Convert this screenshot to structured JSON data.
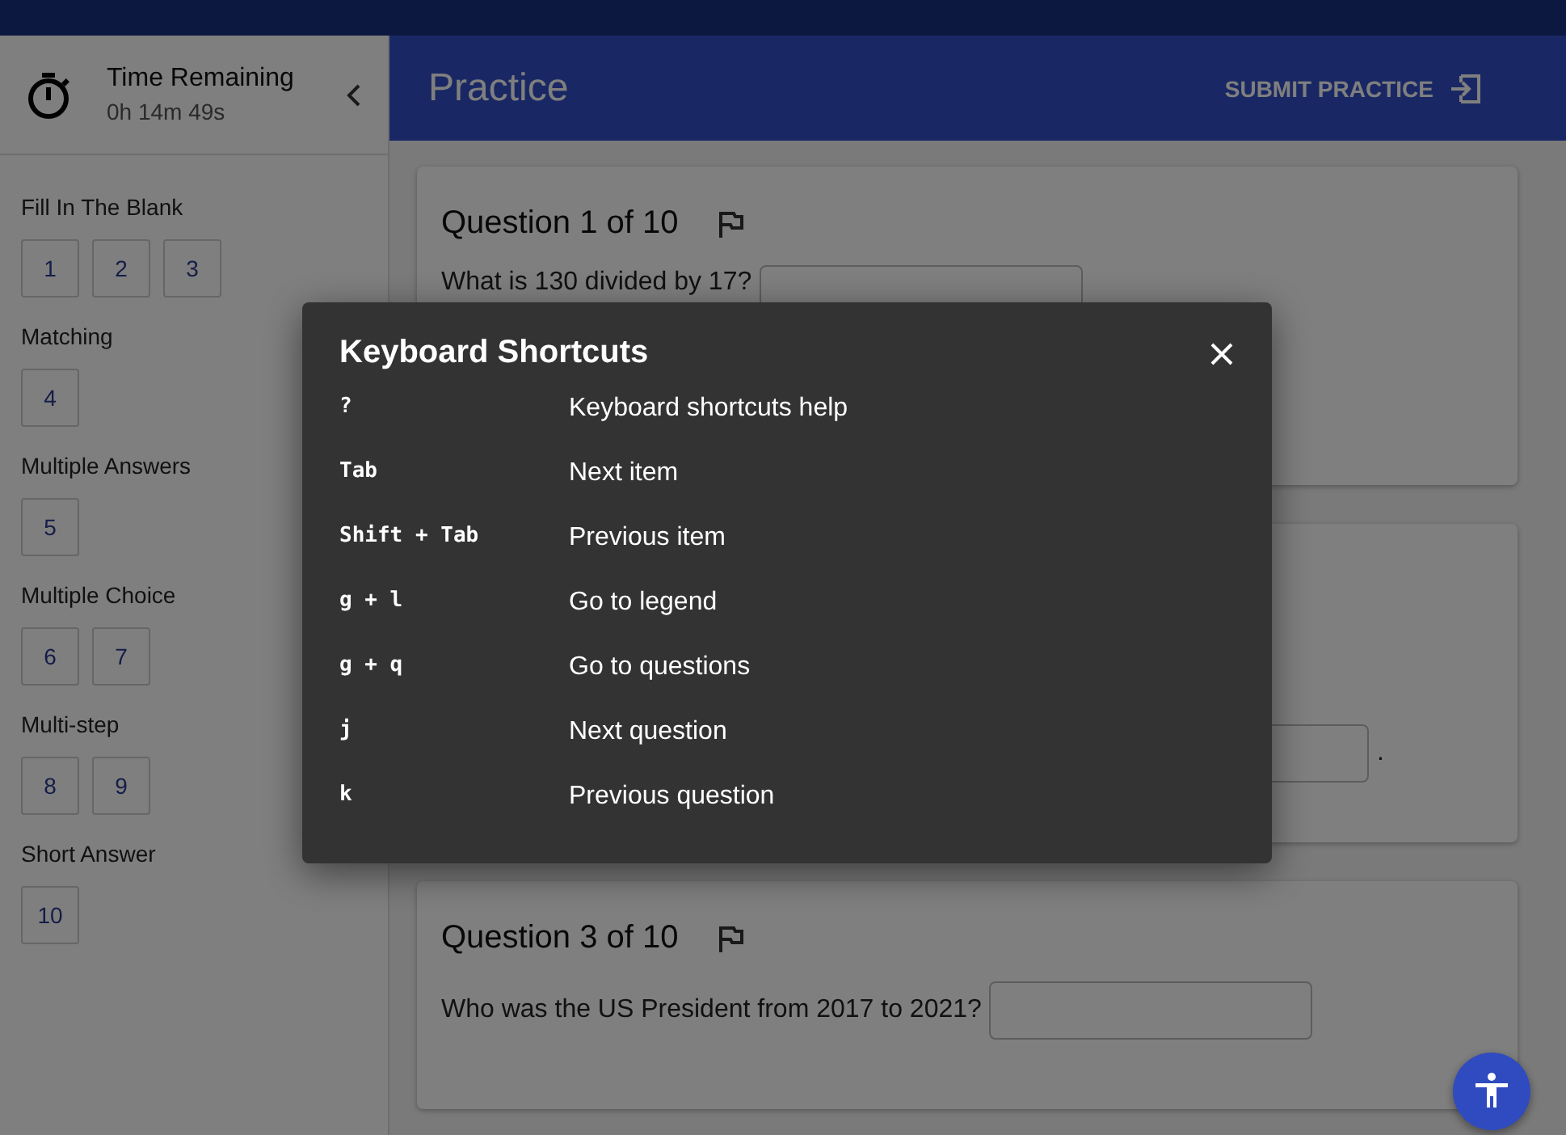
{
  "timer": {
    "label": "Time Remaining",
    "value": "0h 14m 49s"
  },
  "header": {
    "title": "Practice",
    "submit_label": "SUBMIT PRACTICE"
  },
  "legend": [
    {
      "section": "Fill In The Blank",
      "items": [
        "1",
        "2",
        "3"
      ]
    },
    {
      "section": "Matching",
      "items": [
        "4"
      ]
    },
    {
      "section": "Multiple Answers",
      "items": [
        "5"
      ]
    },
    {
      "section": "Multiple Choice",
      "items": [
        "6",
        "7"
      ]
    },
    {
      "section": "Multi-step",
      "items": [
        "8",
        "9"
      ]
    },
    {
      "section": "Short Answer",
      "items": [
        "10"
      ]
    }
  ],
  "questions": [
    {
      "title": "Question 1 of 10",
      "lines": [
        [
          {
            "kind": "text",
            "text": "What is 130 divided by 17?"
          },
          {
            "kind": "input"
          }
        ]
      ]
    },
    {
      "lines": [
        [
          {
            "kind": "input"
          },
          {
            "kind": "text",
            "text": "."
          }
        ]
      ]
    },
    {
      "title": "Question 3 of 10",
      "lines": [
        [
          {
            "kind": "text",
            "text": "Who was the US President from 2017 to 2021?"
          },
          {
            "kind": "input"
          }
        ]
      ]
    }
  ],
  "dialog": {
    "title": "Keyboard Shortcuts",
    "shortcuts": [
      {
        "keys": "?",
        "description": "Keyboard shortcuts help"
      },
      {
        "keys": "Tab",
        "description": "Next item"
      },
      {
        "keys": "Shift + Tab",
        "description": "Previous item"
      },
      {
        "keys": "g + l",
        "description": "Go to legend"
      },
      {
        "keys": "g + q",
        "description": "Go to questions"
      },
      {
        "keys": "j",
        "description": "Next question"
      },
      {
        "keys": "k",
        "description": "Previous question"
      }
    ]
  }
}
